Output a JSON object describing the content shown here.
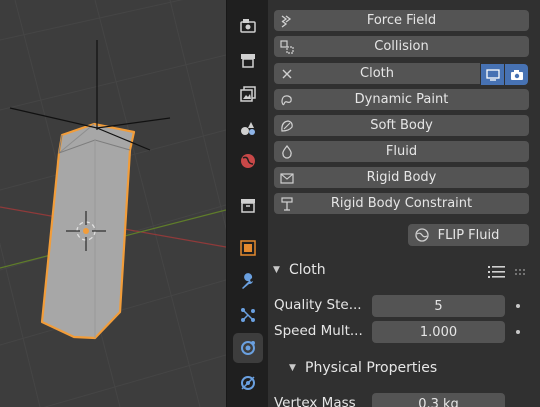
{
  "viewport": {
    "selected_object": "cloth-object",
    "outline_color": "#f29d3a",
    "x_axis_color": "#9b3c3c",
    "y_axis_color": "#6b8e23"
  },
  "tabs": [
    {
      "name": "tool-icon"
    },
    {
      "name": "render-icon"
    },
    {
      "name": "output-icon"
    },
    {
      "name": "view-layer-icon"
    },
    {
      "name": "scene-icon"
    },
    {
      "name": "world-icon"
    },
    {
      "name": "collection-icon"
    },
    {
      "name": "object-icon"
    },
    {
      "name": "modifier-wrench-icon"
    },
    {
      "name": "particles-icon"
    },
    {
      "name": "physics-icon",
      "active": true
    },
    {
      "name": "constraints-icon"
    }
  ],
  "physics": {
    "buttons": [
      {
        "label": "Force Field",
        "icon": "force-field-icon"
      },
      {
        "label": "Collision",
        "icon": "collision-icon"
      },
      {
        "label": "Cloth",
        "icon": "close-x-icon",
        "enabled": true
      },
      {
        "label": "Dynamic Paint",
        "icon": "dynamic-paint-icon"
      },
      {
        "label": "Soft Body",
        "icon": "soft-body-icon"
      },
      {
        "label": "Fluid",
        "icon": "fluid-drop-icon"
      },
      {
        "label": "Rigid Body",
        "icon": "rigid-body-icon"
      },
      {
        "label": "Rigid Body Constraint",
        "icon": "rigid-body-constraint-icon"
      }
    ],
    "flip_fluid_label": "FLIP Fluid",
    "accent_color": "#4772b3"
  },
  "cloth_panel": {
    "title": "Cloth",
    "properties": [
      {
        "label": "Quality Ste...",
        "value": "5"
      },
      {
        "label": "Speed Mult...",
        "value": "1.000"
      }
    ],
    "subpanel_title": "Physical Properties",
    "physical": [
      {
        "label": "Vertex Mass",
        "value": "0.3 kg"
      }
    ]
  }
}
